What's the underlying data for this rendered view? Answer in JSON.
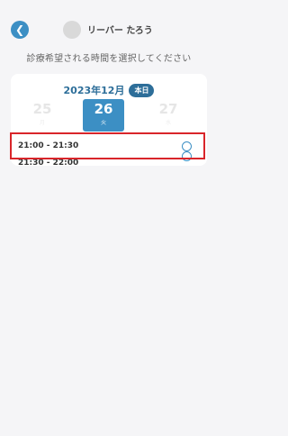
{
  "header": {
    "back_icon": "chevron-left-icon",
    "user_name": "リーバー たろう"
  },
  "instruction": "診療希望される時間を選択してください",
  "calendar": {
    "month": "2023年12月",
    "today_badge": "本日",
    "days": [
      {
        "num": "25",
        "weekday": "月",
        "selected": false
      },
      {
        "num": "26",
        "weekday": "火",
        "selected": true
      },
      {
        "num": "27",
        "weekday": "水",
        "selected": false
      }
    ]
  },
  "slots": [
    {
      "time": "21:00 - 21:30",
      "highlighted": true
    },
    {
      "time": "21:30 - 22:00",
      "highlighted": false
    }
  ],
  "colors": {
    "accent": "#3c8fc4",
    "accent_dark": "#2d6e99",
    "highlight": "#d9252a"
  }
}
